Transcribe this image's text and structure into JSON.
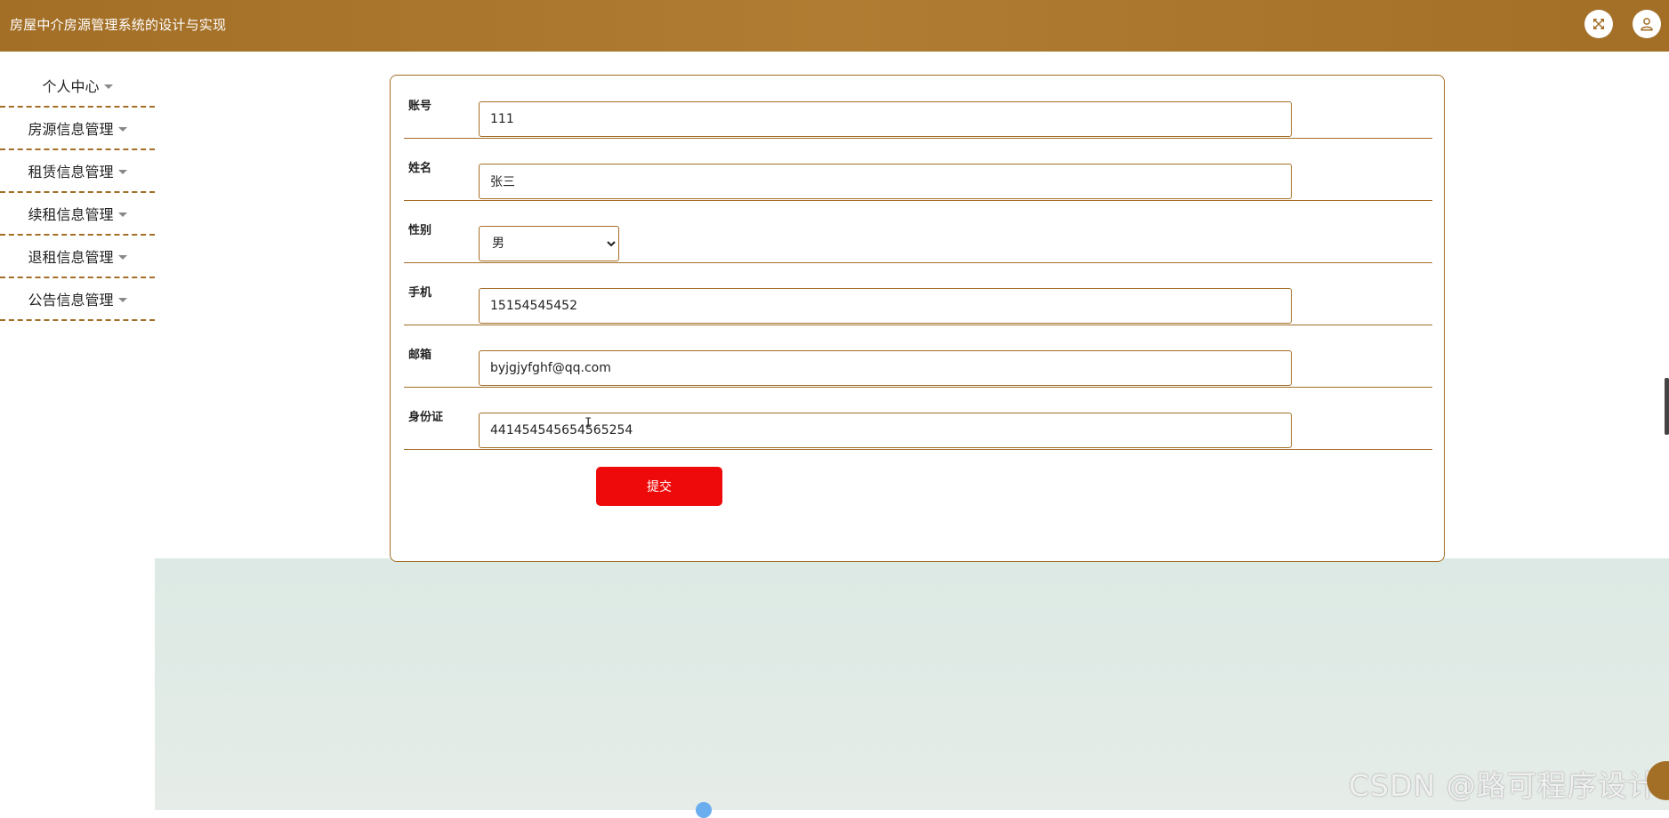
{
  "header": {
    "title": "房屋中介房源管理系统的设计与实现",
    "fullscreen_icon": "expand-icon",
    "user_icon": "user-icon"
  },
  "sidebar": {
    "items": [
      {
        "label": "个人中心"
      },
      {
        "label": "房源信息管理"
      },
      {
        "label": "租赁信息管理"
      },
      {
        "label": "续租信息管理"
      },
      {
        "label": "退租信息管理"
      },
      {
        "label": "公告信息管理"
      }
    ]
  },
  "form": {
    "fields": [
      {
        "label": "账号",
        "value": "111"
      },
      {
        "label": "姓名",
        "value": "张三"
      },
      {
        "label": "性别",
        "value": "男",
        "options": [
          "男"
        ]
      },
      {
        "label": "手机",
        "value": "15154545452"
      },
      {
        "label": "邮箱",
        "value": "byjgjyfghf@qq.com"
      },
      {
        "label": "身份证",
        "value": "441454545654565254"
      }
    ],
    "submit_label": "提交"
  },
  "colors": {
    "primary": "#a36f27",
    "submit": "#ee0a0a",
    "map_bg": "#dfe9e4"
  },
  "watermark": "CSDN @路可程序设计"
}
